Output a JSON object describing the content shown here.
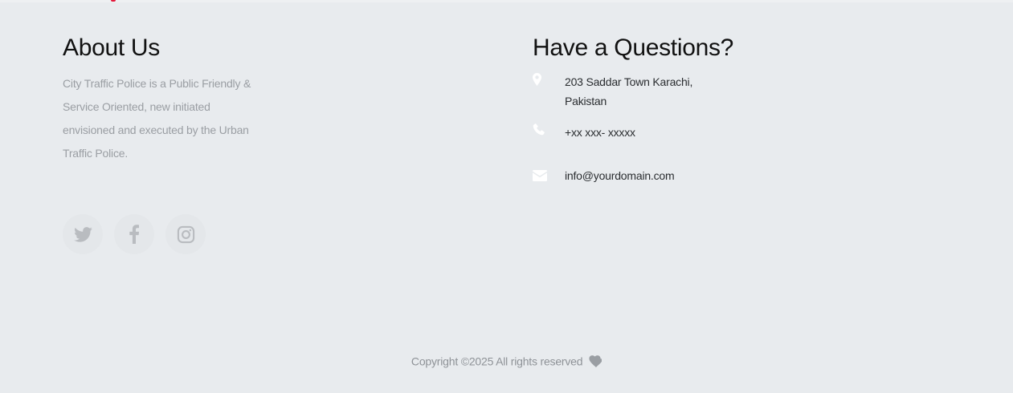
{
  "footer": {
    "about": {
      "title": "About Us",
      "text": "City Traffic Police is a Public Friendly & Service Oriented, new initiated envisioned and executed by the Urban Traffic Police."
    },
    "socials": [
      {
        "icon": "twitter-icon"
      },
      {
        "icon": "facebook-icon"
      },
      {
        "icon": "instagram-icon"
      }
    ],
    "contact": {
      "title": "Have a Questions?",
      "address": "203 Saddar Town Karachi, Pakistan",
      "phone": "+xx xxx- xxxxx",
      "email": "info@yourdomain.com"
    },
    "copyright": {
      "text": "Copyright ©2025 All rights reserved",
      "icon": "heart-icon"
    }
  },
  "colors": {
    "background": "#e8ebee",
    "muted_text": "#9a9ea3",
    "social_icon": "#b9bcc0",
    "contact_icon": "#ffffff",
    "accent": "#e3193b"
  }
}
